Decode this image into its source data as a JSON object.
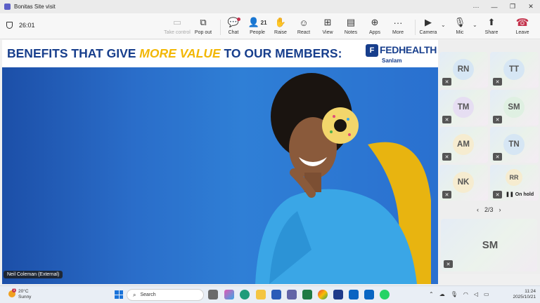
{
  "window": {
    "title": "Bonitas Site visit",
    "buttons": [
      "···",
      "—",
      "❐",
      "✕"
    ]
  },
  "toolbar": {
    "timer": "26:01",
    "items": [
      {
        "label": "Take control",
        "icon": "take-control-icon",
        "glyph": "▭"
      },
      {
        "label": "Pop out",
        "icon": "pop-out-icon",
        "glyph": "⧉"
      },
      {
        "label": "Chat",
        "icon": "chat-icon",
        "glyph": "💬"
      },
      {
        "label": "People",
        "icon": "people-icon",
        "glyph": "👤",
        "count": "21"
      },
      {
        "label": "Raise",
        "icon": "raise-hand-icon",
        "glyph": "✋"
      },
      {
        "label": "React",
        "icon": "react-icon",
        "glyph": "☺"
      },
      {
        "label": "View",
        "icon": "view-icon",
        "glyph": "⊞"
      },
      {
        "label": "Notes",
        "icon": "notes-icon",
        "glyph": "▤"
      },
      {
        "label": "Apps",
        "icon": "apps-icon",
        "glyph": "⊕"
      },
      {
        "label": "More",
        "icon": "more-icon",
        "glyph": "···"
      },
      {
        "label": "Camera",
        "icon": "camera-off-icon",
        "glyph": "▶"
      },
      {
        "label": "Mic",
        "icon": "mic-off-icon",
        "glyph": "🎙"
      },
      {
        "label": "Share",
        "icon": "share-icon",
        "glyph": "⬆"
      },
      {
        "label": "Leave",
        "icon": "leave-icon",
        "glyph": "☎"
      }
    ]
  },
  "slide": {
    "headline_before": "BENEFITS THAT GIVE ",
    "headline_emphasis": "MORE VALUE",
    "headline_after": " TO OUR MEMBERS:",
    "brand": "FEDHEALTH",
    "partner": "Sanlam",
    "presenter": "Neil Coleman (External)"
  },
  "participants": [
    {
      "initials": "RN",
      "color": "#d6e6f4"
    },
    {
      "initials": "TT",
      "color": "#d6e6f4"
    },
    {
      "initials": "TM",
      "color": "#e6def2"
    },
    {
      "initials": "SM",
      "color": "#dff0e2"
    },
    {
      "initials": "AM",
      "color": "#f6ecd0"
    },
    {
      "initials": "TN",
      "color": "#d6e6f4"
    },
    {
      "initials": "NK",
      "color": "#f6ecd0"
    },
    {
      "initials": "RR",
      "color": "#f6ecd0",
      "status": "On hold"
    }
  ],
  "pager": {
    "text": "2/3"
  },
  "spotlight": {
    "initials": "SM"
  },
  "taskbar": {
    "weather_temp": "20°C",
    "weather_desc": "Sunny",
    "weather_badge": "1",
    "search": "Search",
    "time": "11:24",
    "date": "2025/10/21"
  },
  "colors": {
    "brand_blue": "#173e8c",
    "accent_yellow": "#f2b705",
    "leave_red": "#c4314b"
  }
}
